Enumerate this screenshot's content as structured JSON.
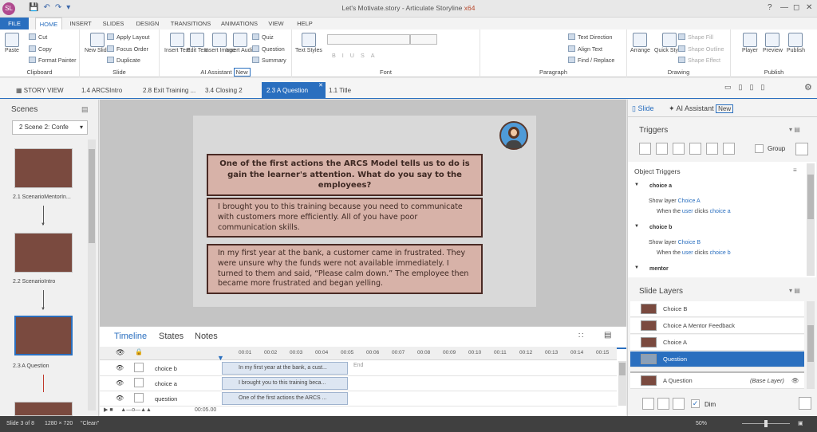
{
  "window": {
    "title_main": "Let's Motivate.story - Articulate Storyline",
    "title_arch": "x64"
  },
  "tabs": [
    {
      "label": "FILE"
    },
    {
      "label": "HOME"
    },
    {
      "label": "INSERT"
    },
    {
      "label": "SLIDES"
    },
    {
      "label": "DESIGN"
    },
    {
      "label": "TRANSITIONS"
    },
    {
      "label": "ANIMATIONS"
    },
    {
      "label": "VIEW"
    },
    {
      "label": "HELP"
    }
  ],
  "ribbon": {
    "clipboard": {
      "paste": "Paste",
      "cut": "Cut",
      "copy": "Copy",
      "format_painter": "Format Painter",
      "label": "Clipboard"
    },
    "slide": {
      "new_slide": "New Slide",
      "apply_layout": "Apply Layout",
      "focus_order": "Focus Order",
      "duplicate": "Duplicate",
      "label": "Slide"
    },
    "ai": {
      "insert_text": "Insert Text",
      "edit_text": "Edit Text",
      "insert_image": "Insert Image",
      "insert_audio": "Insert Audio",
      "quiz": "Quiz",
      "question": "Question",
      "summary": "Summary",
      "label": "AI Assistant",
      "badge": "New"
    },
    "font": {
      "text_styles": "Text Styles",
      "label": "Font"
    },
    "paragraph": {
      "text_direction": "Text Direction",
      "align_text": "Align Text",
      "find_replace": "Find / Replace",
      "label": "Paragraph"
    },
    "drawing": {
      "arrange": "Arrange",
      "quick_styles": "Quick Styles",
      "shape_fill": "Shape Fill",
      "shape_outline": "Shape Outline",
      "shape_effect": "Shape Effect",
      "label": "Drawing"
    },
    "publish": {
      "player": "Player",
      "preview": "Preview",
      "publish": "Publish",
      "label": "Publish"
    }
  },
  "doc_tabs": [
    {
      "label": "STORY VIEW"
    },
    {
      "label": "1.4 ARCSIntro"
    },
    {
      "label": "2.8 Exit Training ..."
    },
    {
      "label": "3.4 Closing 2"
    },
    {
      "label": "2.3 A Question"
    },
    {
      "label": "1.1 Title"
    }
  ],
  "scenes": {
    "header": "Scenes",
    "selected": "2 Scene 2: Confe",
    "items": [
      {
        "label": "2.1 ScenarioMentorIn..."
      },
      {
        "label": "2.2 ScenarioIntro"
      },
      {
        "label": "2.3 A Question"
      }
    ]
  },
  "slide": {
    "question": "One of the first actions the ARCS Model tells us to do is gain the learner's attention. What do you say to the employees?",
    "choice1": "I brought you to this training because you need to communicate with customers more efficiently. All of you have poor communication skills.",
    "choice2": "In my first year at the bank, a customer came in frustrated. They were unsure why the funds were not available immediately. I turned to them and said, “Please calm down.” The employee then became more frustrated and began yelling."
  },
  "timeline": {
    "tabs": [
      {
        "label": "Timeline"
      },
      {
        "label": "States"
      },
      {
        "label": "Notes"
      }
    ],
    "ticks": [
      "00:01",
      "00:02",
      "00:03",
      "00:04",
      "00:05",
      "00:06",
      "00:07",
      "00:08",
      "00:09",
      "00:10",
      "00:11",
      "00:12",
      "00:13",
      "00:14",
      "00:15"
    ],
    "end_label": "End",
    "rows": [
      {
        "name": "choice b",
        "bar": "In my first year at the bank, a cust..."
      },
      {
        "name": "choice a",
        "bar": "I brought you to this training beca..."
      },
      {
        "name": "question",
        "bar": "One of the first actions the ARCS ..."
      }
    ],
    "duration": "00:05.00"
  },
  "right": {
    "tab_slide": "Slide",
    "tab_ai": "AI Assistant",
    "tab_ai_badge": "New",
    "triggers_header": "Triggers",
    "group_label": "Group",
    "object_triggers": "Object Triggers",
    "trig_a_title": "choice a",
    "trig_a_action": "Show layer",
    "trig_a_layer": "Choice A",
    "trig_a_when": "When the",
    "trig_a_user": "user",
    "trig_a_clicks": "clicks",
    "trig_a_obj": "choice a",
    "trig_b_title": "choice b",
    "trig_b_action": "Show layer",
    "trig_b_layer": "Choice B",
    "trig_b_when": "When the",
    "trig_b_user": "user",
    "trig_b_clicks": "clicks",
    "trig_b_obj": "choice b",
    "trig_c_title": "mentor",
    "layers_header": "Slide Layers",
    "layers": [
      {
        "label": "Choice B"
      },
      {
        "label": "Choice A Mentor Feedback"
      },
      {
        "label": "Choice A"
      },
      {
        "label": "Question"
      },
      {
        "label": "A Question"
      }
    ],
    "base_layer": "(Base Layer)",
    "dim_label": "Dim"
  },
  "status": {
    "slide": "Slide 3 of 8",
    "size": "1280 × 720",
    "theme": "\"Clean\"",
    "zoom": "50%"
  },
  "colors": {
    "accent": "#2a6fbf",
    "slide_box": "#d7b2a8",
    "box_border": "#4a2a24"
  }
}
